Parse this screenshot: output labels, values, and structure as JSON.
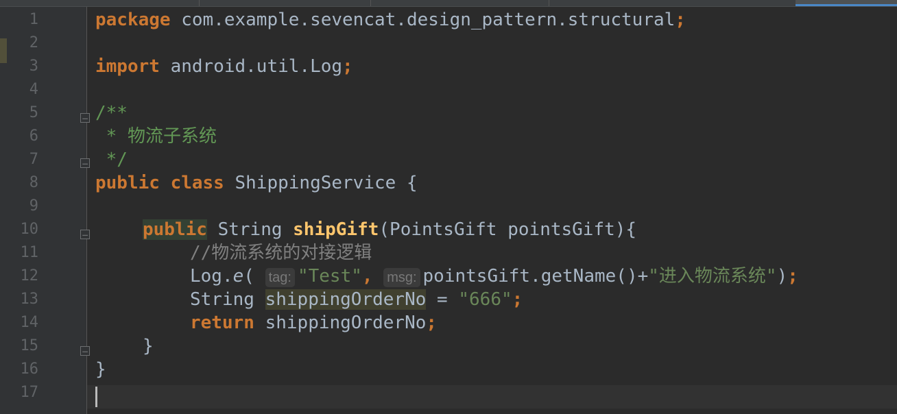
{
  "editor": {
    "line_numbers": [
      "1",
      "2",
      "3",
      "4",
      "5",
      "6",
      "7",
      "8",
      "9",
      "10",
      "11",
      "12",
      "13",
      "14",
      "15",
      "16",
      "17"
    ],
    "code": {
      "l1_kw": "package",
      "l1_rest": " com.example.sevencat.design_pattern.structural",
      "l1_semi": ";",
      "l3_kw": "import",
      "l3_rest": " android.util.Log",
      "l3_semi": ";",
      "l5": "/**",
      "l6": " * 物流子系统",
      "l7": " */",
      "l8_kw": "public class",
      "l8_rest": " ShippingService {",
      "l10_kw": "public",
      "l10_type": " String ",
      "l10_fn": "shipGift",
      "l10_rest": "(PointsGift pointsGift){",
      "l11": "//物流系统的对接逻辑",
      "l12_pre": "Log.",
      "l12_method": "e",
      "l12_open": "( ",
      "l12_hint1": "tag:",
      "l12_str1": "\"Test\"",
      "l12_comma": ", ",
      "l12_hint2": "msg:",
      "l12_mid": "pointsGift.getName()+",
      "l12_str2": "\"进入物流系统\"",
      "l12_close": ")",
      "l12_semi": ";",
      "l13_type": "String ",
      "l13_var": "shippingOrderNo",
      "l13_eq": " = ",
      "l13_str": "\"666\"",
      "l13_semi": ";",
      "l14_kw": "return",
      "l14_rest": " shippingOrderNo",
      "l14_semi": ";",
      "l15": "}",
      "l16": "}"
    }
  }
}
